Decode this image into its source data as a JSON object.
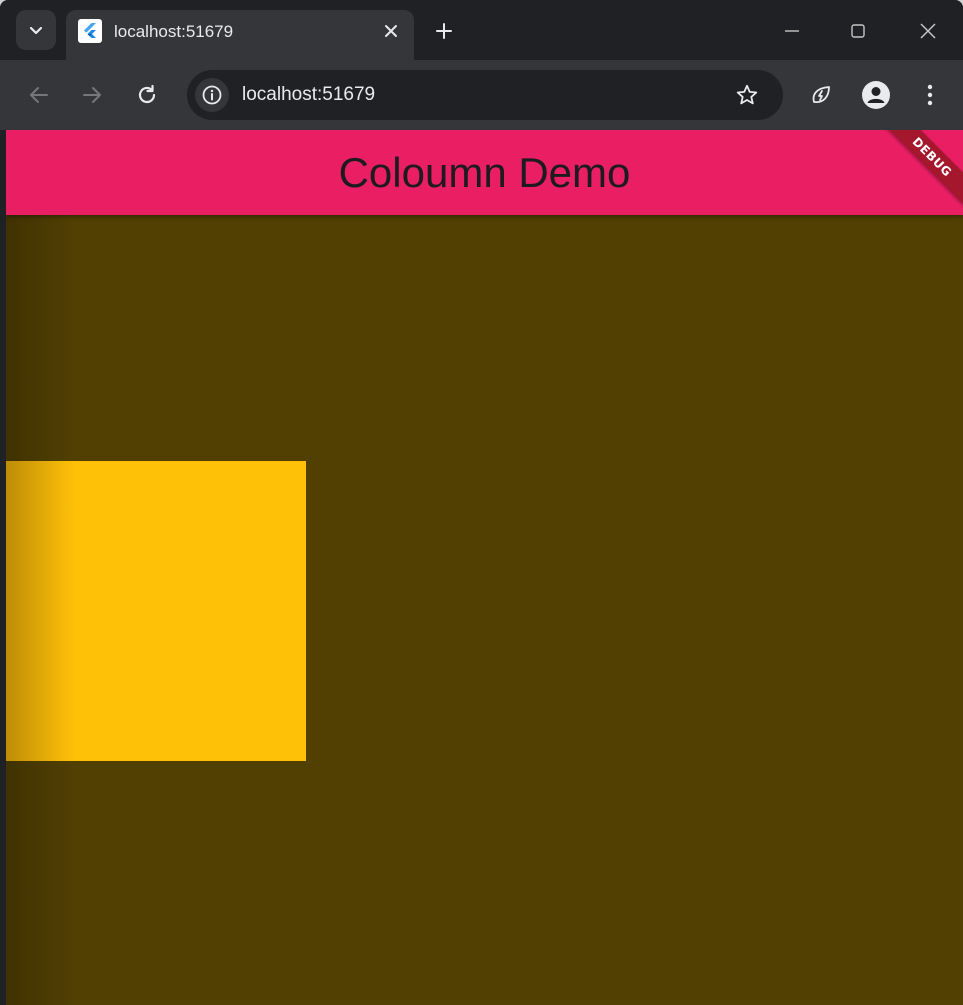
{
  "browser": {
    "tab": {
      "title": "localhost:51679"
    },
    "address_bar": {
      "url": "localhost:51679"
    }
  },
  "app": {
    "appbar_title": "Coloumn Demo",
    "debug_banner": "DEBUG",
    "colors": {
      "appbar": "#e91e63",
      "background": "#524003",
      "box": "#ffc107",
      "debug_banner": "#a4172c"
    }
  },
  "icons": {
    "tab_search": "chevron-down-icon",
    "favicon": "flutter-icon",
    "tab_close": "close-icon",
    "new_tab": "plus-icon",
    "minimize": "minimize-icon",
    "maximize": "maximize-icon",
    "window_close": "close-icon",
    "back": "arrow-left-icon",
    "forward": "arrow-right-icon",
    "reload": "reload-icon",
    "site_info": "info-icon",
    "bookmark": "star-icon",
    "performance": "leaf-bolt-icon",
    "profile": "profile-icon",
    "menu": "more-vert-icon"
  }
}
